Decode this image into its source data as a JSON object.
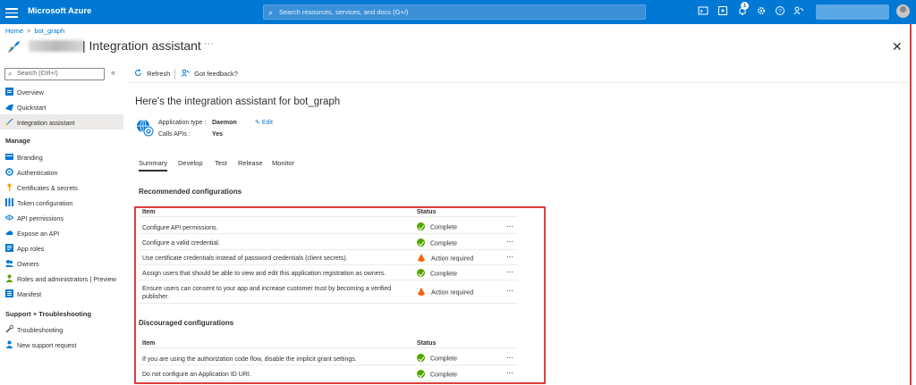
{
  "topbar": {
    "brand": "Microsoft Azure",
    "search_placeholder": "Search resources, services, and docs (G+/)",
    "notification_count": "1"
  },
  "breadcrumb": {
    "home": "Home",
    "current": "bot_graph",
    "separator": ">"
  },
  "page": {
    "title": "| Integration assistant",
    "more": "···",
    "close": "✕"
  },
  "sidebar": {
    "search_placeholder": "Search (Ctrl+/)",
    "collapse": "«",
    "top_items": [
      {
        "label": "Overview"
      },
      {
        "label": "Quickstart"
      },
      {
        "label": "Integration assistant"
      }
    ],
    "manage_title": "Manage",
    "manage_items": [
      {
        "label": "Branding"
      },
      {
        "label": "Authentication"
      },
      {
        "label": "Certificates & secrets"
      },
      {
        "label": "Token configuration"
      },
      {
        "label": "API permissions"
      },
      {
        "label": "Expose an API"
      },
      {
        "label": "App roles"
      },
      {
        "label": "Owners"
      },
      {
        "label": "Roles and administrators | Preview"
      },
      {
        "label": "Manifest"
      }
    ],
    "support_title": "Support + Troubleshooting",
    "support_items": [
      {
        "label": "Troubleshooting"
      },
      {
        "label": "New support request"
      }
    ]
  },
  "toolbar": {
    "refresh": "Refresh",
    "feedback": "Got feedback?"
  },
  "main": {
    "heading": "Here's the integration assistant for bot_graph",
    "app_type_label": "Application type :",
    "app_type_value": "Daemon",
    "calls_apis_label": "Calls APIs :",
    "calls_apis_value": "Yes",
    "edit": "Edit",
    "tabs": [
      "Summary",
      "Develop",
      "Test",
      "Release",
      "Monitor"
    ],
    "recommended": {
      "title": "Recommended configurations",
      "col_item": "Item",
      "col_status": "Status",
      "rows": [
        {
          "item": "Configure API permissions.",
          "status": "Complete",
          "kind": "ok"
        },
        {
          "item": "Configure a valid credential.",
          "status": "Complete",
          "kind": "ok"
        },
        {
          "item": "Use certificate credentials instead of password credentials (client secrets).",
          "status": "Action required",
          "kind": "warn"
        },
        {
          "item": "Assign users that should be able to view and edit this application registration as owners.",
          "status": "Complete",
          "kind": "ok"
        },
        {
          "item": "Ensure users can consent to your app and increase customer trust by becoming a verified publisher.",
          "status": "Action required",
          "kind": "warn"
        }
      ]
    },
    "discouraged": {
      "title": "Discouraged configurations",
      "col_item": "Item",
      "col_status": "Status",
      "rows": [
        {
          "item": "If you are using the authorization code flow, disable the implicit grant settings.",
          "status": "Complete",
          "kind": "ok"
        },
        {
          "item": "Do not configure an Application ID URI.",
          "status": "Complete",
          "kind": "ok"
        }
      ]
    },
    "row_more": "···"
  },
  "colors": {
    "brand": "#0078d4",
    "ok": "#57a300",
    "warn": "#f7630c",
    "highlight": "#e03c3c"
  }
}
